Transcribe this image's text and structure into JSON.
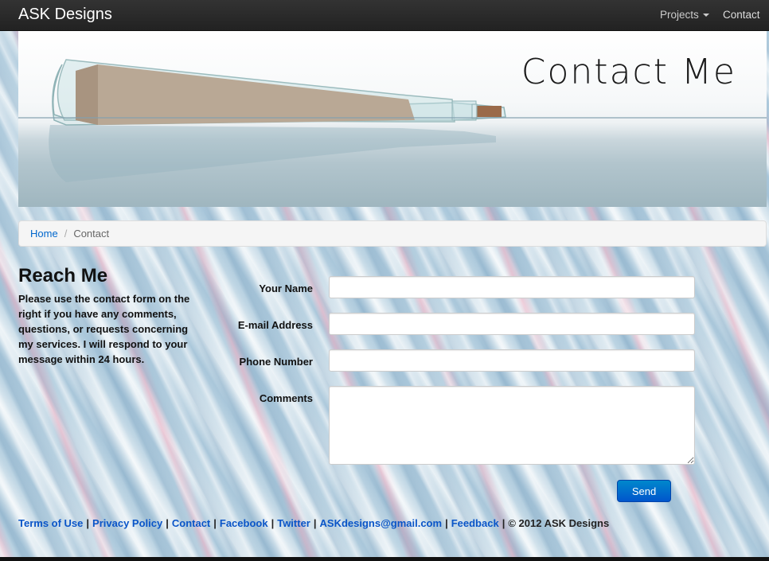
{
  "navbar": {
    "brand": "ASK Designs",
    "projects_label": "Projects",
    "contact_label": "Contact"
  },
  "hero": {
    "title": "Contact Me"
  },
  "breadcrumb": {
    "home": "Home",
    "separator": "/",
    "current": "Contact"
  },
  "intro": {
    "title": "Reach Me",
    "text": "Please use the contact form on the right if you have any comments, questions, or requests concerning my services. I will respond to your message within 24 hours."
  },
  "form": {
    "name_label": "Your Name",
    "email_label": "E-mail Address",
    "phone_label": "Phone Number",
    "comments_label": "Comments",
    "name_value": "",
    "email_value": "",
    "phone_value": "",
    "comments_value": "",
    "send_label": "Send"
  },
  "footer": {
    "links": [
      "Terms of Use",
      "Privacy Policy",
      "Contact",
      "Facebook",
      "Twitter",
      "ASKdesigns@gmail.com",
      "Feedback"
    ],
    "separator": "|",
    "copyright": "© 2012 ASK Designs"
  },
  "colors": {
    "navbar": "#222222",
    "link": "#0066cc",
    "button": "#0077cc"
  }
}
